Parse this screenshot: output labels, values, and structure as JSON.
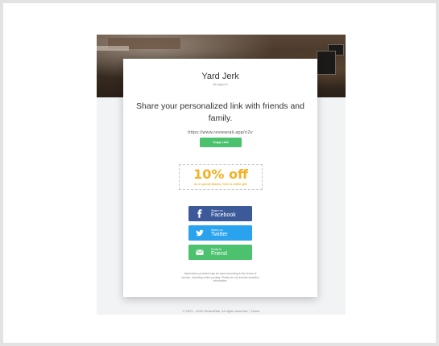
{
  "business": {
    "name": "Yard Jerk",
    "handle": "@rdgpjerk"
  },
  "headline": "Share your personalized link with friends and family.",
  "share_url": "https://www.reviewrail.app/r/2v",
  "copy_label": "Copy Link",
  "coupon": {
    "offer": "10% off",
    "message": "As a special thanks, here is a little gift."
  },
  "share_buttons": [
    {
      "small": "Share on",
      "big": "Facebook",
      "icon": "facebook-icon",
      "color": "#3c5a99"
    },
    {
      "small": "Share on",
      "big": "Twitter",
      "icon": "twitter-icon",
      "color": "#2aa3ef"
    },
    {
      "small": "Email to",
      "big": "Friend",
      "icon": "envelope-icon",
      "color": "#4cc26e"
    }
  ],
  "disclaimer": "Information provided may be used according to the terms of service, including online posting. Please do not include sensitive information.",
  "footer": {
    "copyright": "© 2021 - 2022 ReviewRail. All rights reserved.",
    "separator": "|",
    "terms_label": "Terms"
  },
  "colors": {
    "accent_green": "#4cc26e",
    "coupon_yellow": "#f4b124"
  }
}
